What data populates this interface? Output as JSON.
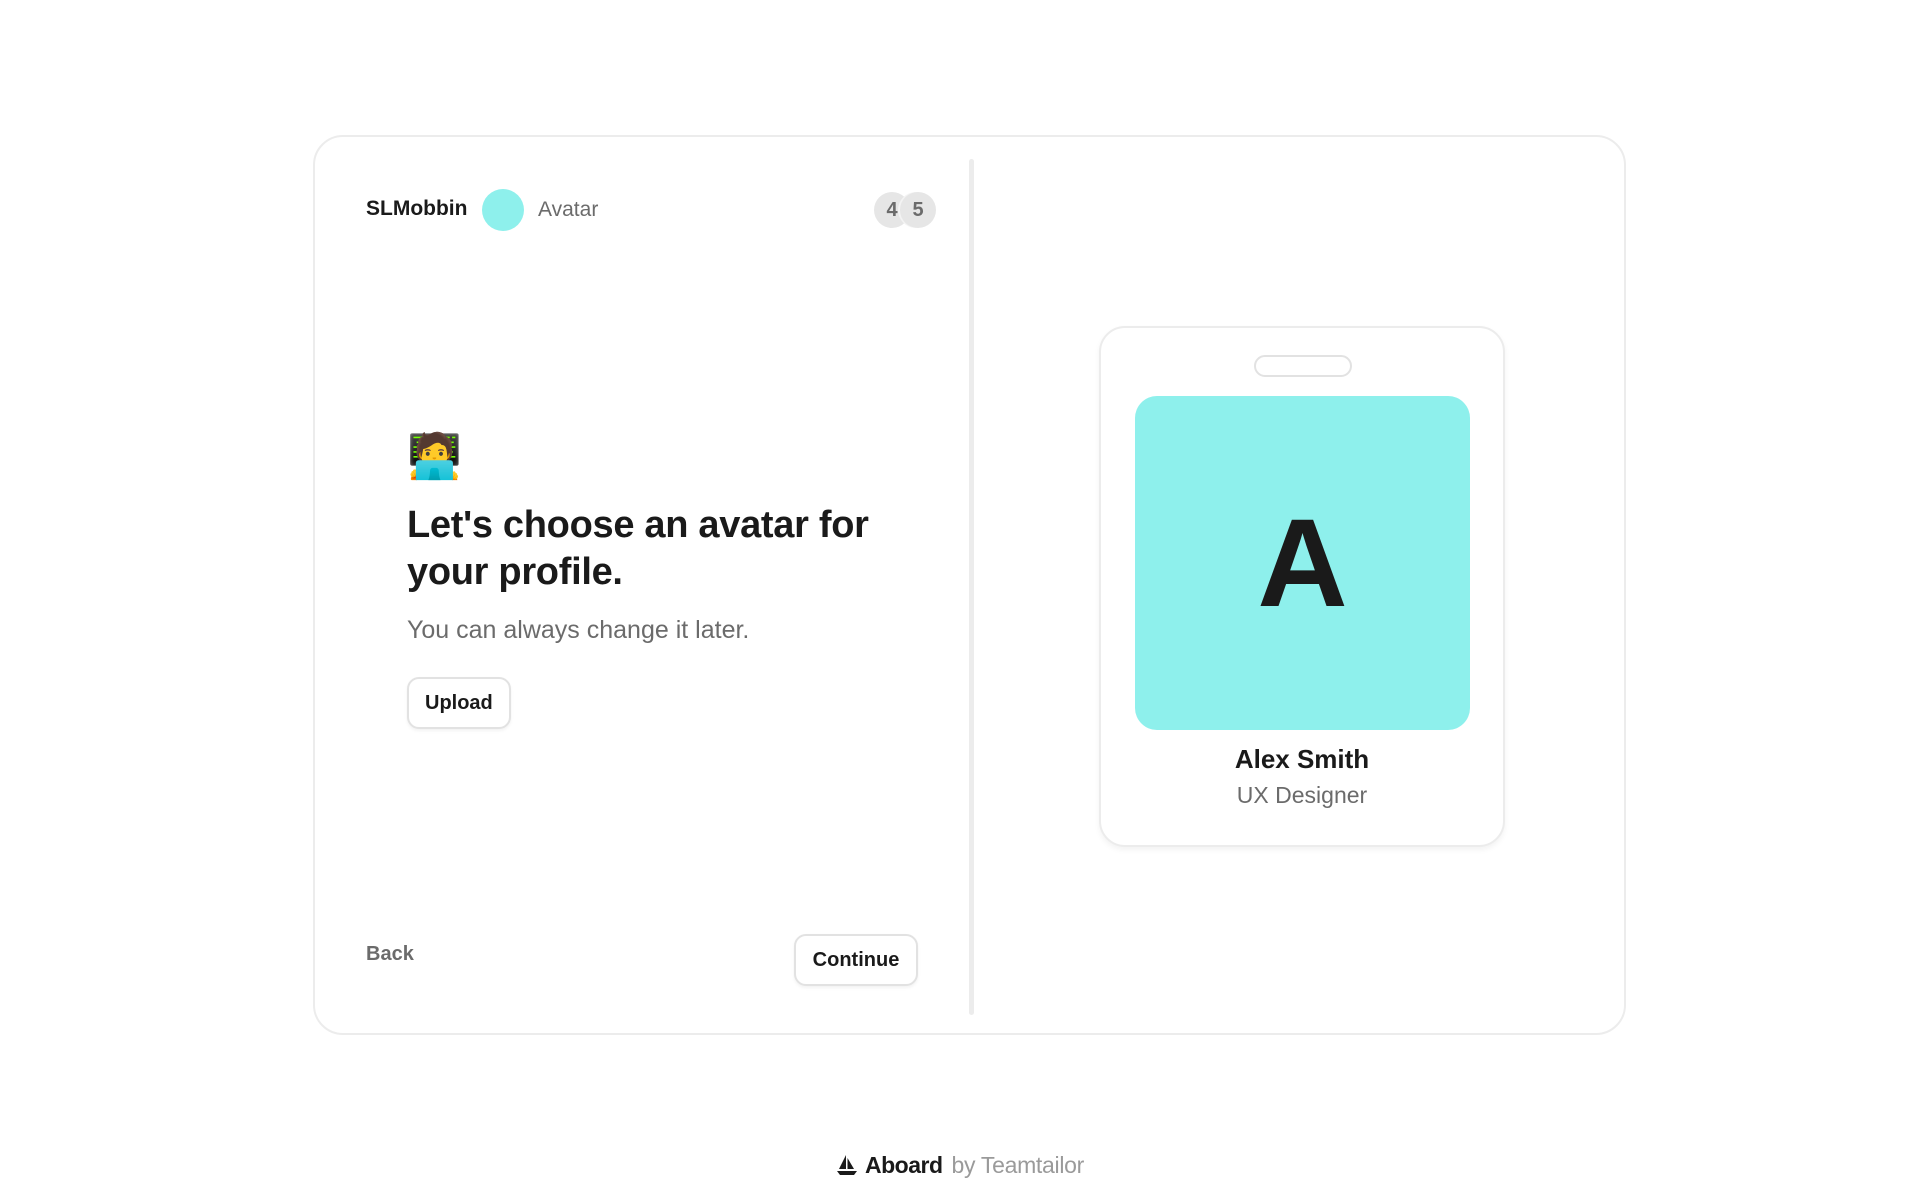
{
  "header": {
    "brand": "SLMobbin",
    "step_label": "Avatar",
    "step_current": "4",
    "step_total": "5",
    "dot_color": "#8ef0ec"
  },
  "main": {
    "emoji": "🧑‍💻",
    "heading": "Let's choose an avatar for your profile.",
    "subtext": "You can always change it later.",
    "upload_label": "Upload"
  },
  "nav": {
    "back_label": "Back",
    "continue_label": "Continue"
  },
  "badge": {
    "avatar_letter": "A",
    "avatar_color": "#8ef0ec",
    "name": "Alex Smith",
    "role": "UX Designer"
  },
  "footer": {
    "logo_icon": "sailboat-icon",
    "brand": "Aboard",
    "by": "by Teamtailor"
  }
}
